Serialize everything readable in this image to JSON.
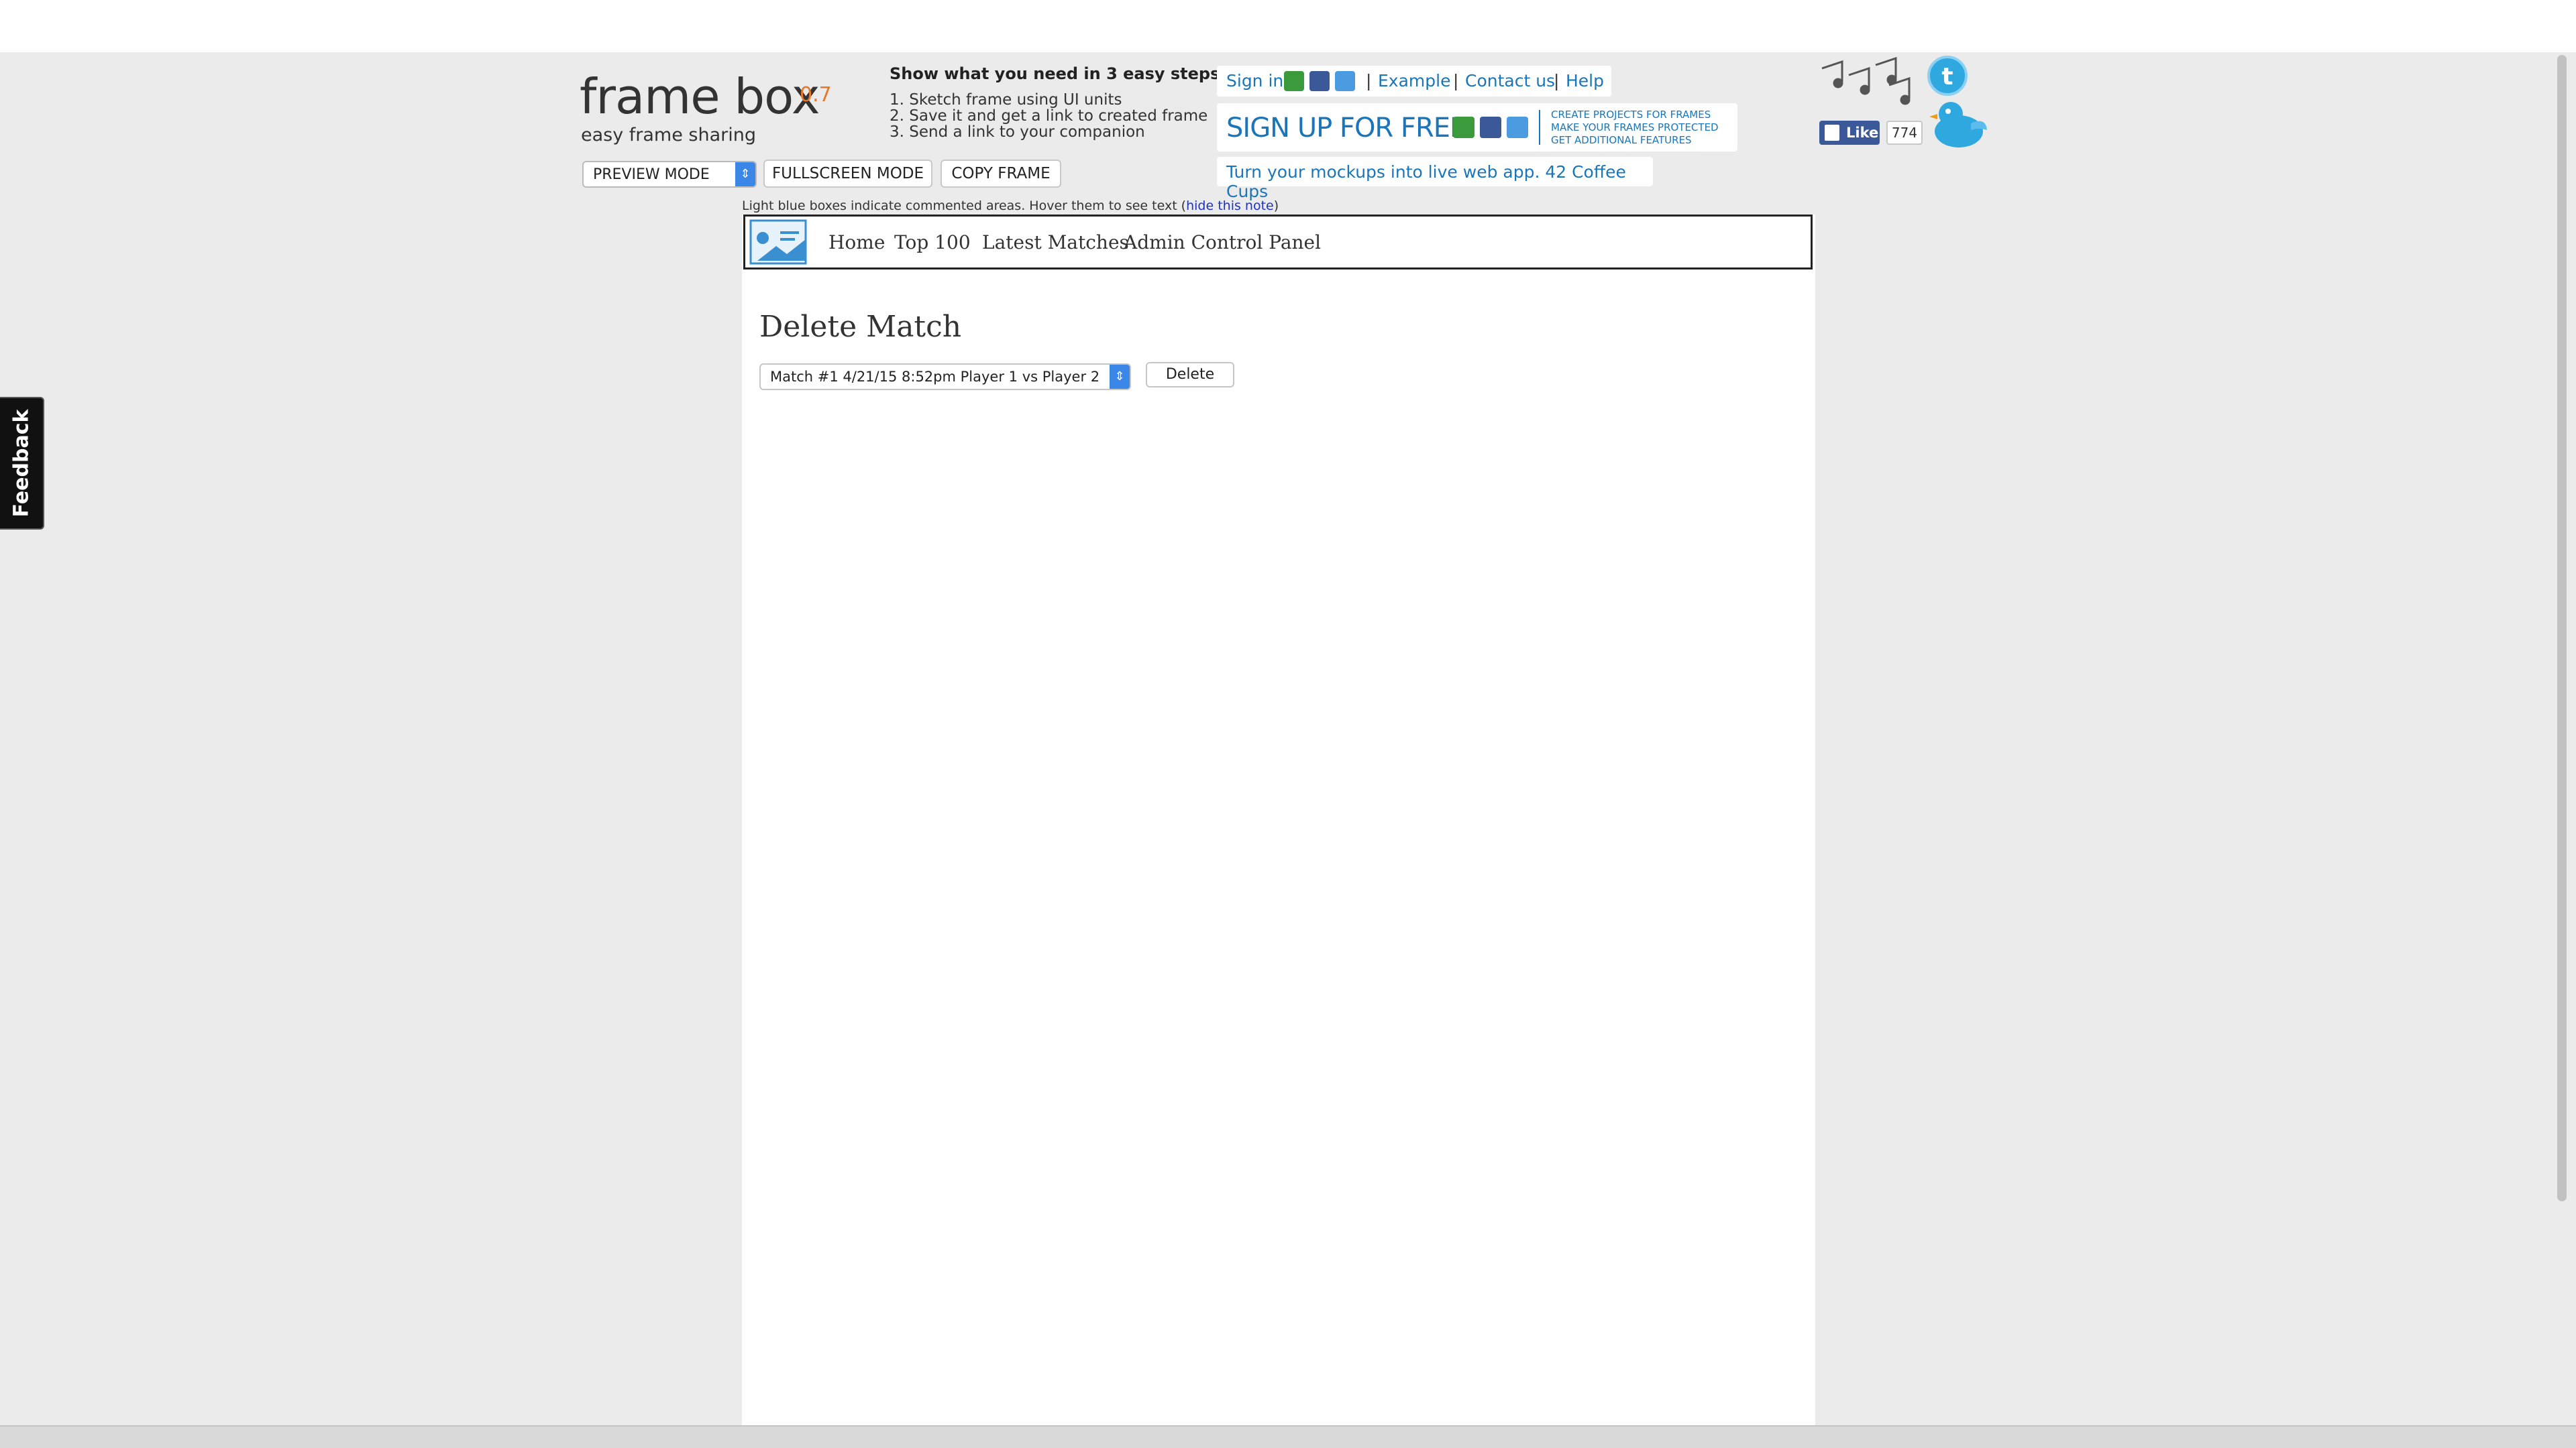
{
  "logo": {
    "name": "frame box",
    "version": "0.7",
    "tagline": "easy frame sharing"
  },
  "steps": {
    "title": "Show what you need in 3 easy steps:",
    "items": [
      "1. Sketch frame using UI units",
      "2. Save it and get a link to created frame",
      "3. Send a link to your companion"
    ]
  },
  "controls": {
    "mode_select": "PREVIEW MODE",
    "fullscreen": "FULLSCREEN MODE",
    "copy": "COPY FRAME"
  },
  "header_links": {
    "sign_in": "Sign in",
    "separator": "|",
    "example": "Example",
    "contact": "Contact us",
    "help": "Help"
  },
  "signup": {
    "big": "SIGN UP FOR FREE",
    "features": [
      "CREATE PROJECTS FOR FRAMES",
      "MAKE YOUR FRAMES PROTECTED",
      "GET ADDITIONAL FEATURES"
    ]
  },
  "promo": "Turn your mockups into live web app. 42 Coffee Cups",
  "social": {
    "like": "Like",
    "count": "774"
  },
  "note": {
    "text": "Light blue boxes indicate commented areas. Hover them to see text (",
    "link": "hide this note",
    "close": ")"
  },
  "nav": {
    "items": [
      "Home",
      "Top 100",
      "Latest Matches",
      "Admin Control Panel"
    ]
  },
  "page": {
    "title": "Delete Match",
    "match_select": "Match #1 4/21/15 8:52pm Player 1 vs Player 2",
    "delete_label": "Delete"
  },
  "feedback": "Feedback",
  "colors": {
    "accent": "#1a76b8",
    "version": "#e8762b",
    "select_arrow": "#3b87e8",
    "facebook": "#3b5998"
  }
}
